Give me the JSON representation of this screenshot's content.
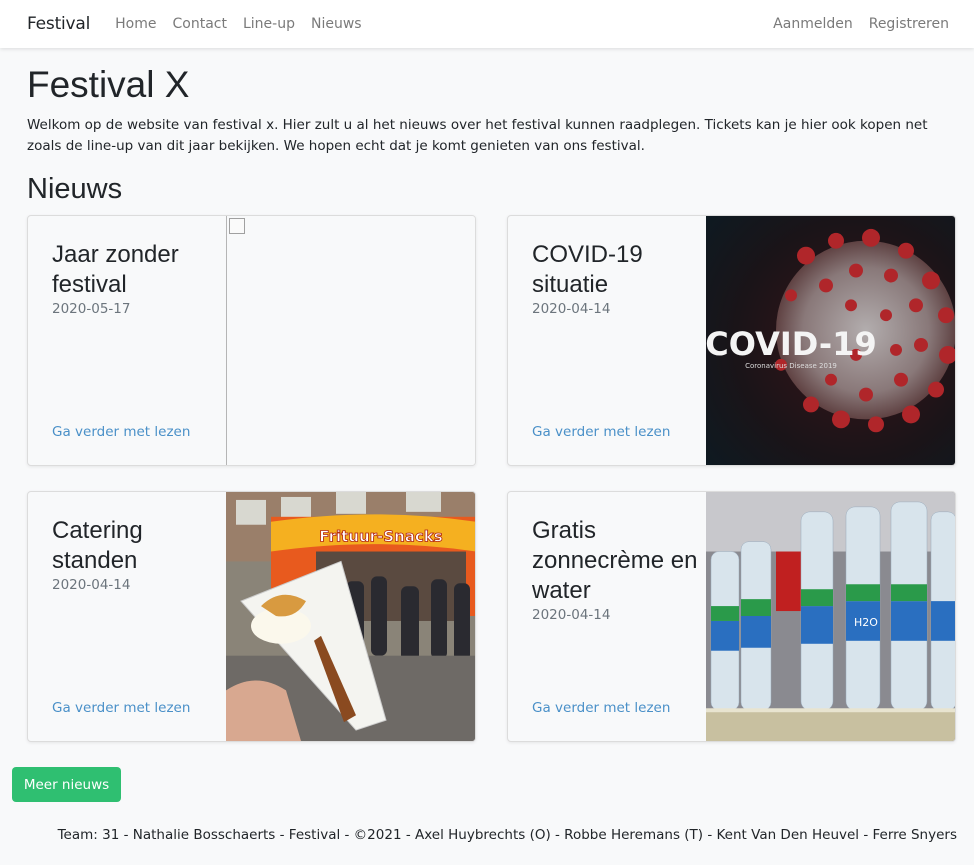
{
  "navbar": {
    "brand": "Festival",
    "links": [
      "Home",
      "Contact",
      "Line-up",
      "Nieuws"
    ],
    "right_links": [
      "Aanmelden",
      "Registreren"
    ]
  },
  "main": {
    "title": "Festival X",
    "intro": "Welkom op de website van festival x. Hier zult u al het nieuws over het festival kunnen raadplegen. Tickets kan je hier ook kopen net zoals de line-up van dit jaar bekijken. We hopen echt dat je komt genieten van ons festival.",
    "news_title": "Nieuws",
    "cards": [
      {
        "title": "Jaar zonder festival",
        "date": "2020-05-17",
        "link": "Ga verder met lezen",
        "image": "broken-image"
      },
      {
        "title": "COVID-19 situatie",
        "date": "2020-04-14",
        "link": "Ga verder met lezen",
        "image": "covid-image",
        "image_text": "COVID-19",
        "image_subtext": "Coronavirus Disease 2019"
      },
      {
        "title": "Catering standen",
        "date": "2020-04-14",
        "link": "Ga verder met lezen",
        "image": "frituur-image",
        "image_text": "Frituur-Snacks"
      },
      {
        "title": "Gratis zonnecrème en water",
        "date": "2020-04-14",
        "link": "Ga verder met lezen",
        "image": "water-bottles-image",
        "image_text": "H2O"
      }
    ],
    "more_button": "Meer nieuws"
  },
  "footer": {
    "text": "Team: 31 - Nathalie Bosschaerts - Festival - ©2021 - Axel Huybrechts (O) - Robbe Heremans (T) - Kent Van Den Heuvel - Ferre Snyers"
  },
  "colors": {
    "accent_button": "#2fbf71",
    "link": "#4a90c8",
    "muted": "#6c757d"
  }
}
